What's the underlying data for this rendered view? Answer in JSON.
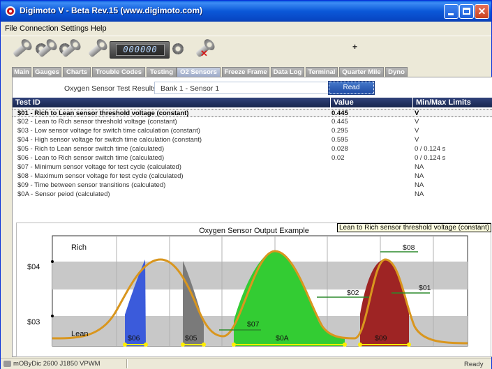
{
  "window": {
    "title": "Digimoto V - Beta Rev.15 (www.digimoto.com)"
  },
  "menu": [
    "File",
    "Connection",
    "Settings",
    "Help"
  ],
  "toolbar": {
    "counter": "000000"
  },
  "tabs": [
    {
      "label": "Main"
    },
    {
      "label": "Gauges"
    },
    {
      "label": "Charts"
    },
    {
      "label": "Trouble Codes"
    },
    {
      "label": "Testing"
    },
    {
      "label": "O2 Sensors",
      "active": true
    },
    {
      "label": "Freeze Frame"
    },
    {
      "label": "Data Log"
    },
    {
      "label": "Terminal"
    },
    {
      "label": "Quarter Mile"
    },
    {
      "label": "Dyno"
    }
  ],
  "sensor": {
    "label": "Oxygen Sensor Test Results:",
    "selected": "Bank 1 - Sensor 1",
    "read_button": "Read"
  },
  "table": {
    "headers": [
      "Test ID",
      "Value",
      "Min/Max Limits"
    ],
    "rows": [
      {
        "id": "$01 - Rich to Lean sensor threshold voltage (constant)",
        "value": "0.445",
        "limits": "V",
        "selected": true
      },
      {
        "id": "$02 - Lean to Rich sensor threshold voltage (constant)",
        "value": "0.445",
        "limits": "V"
      },
      {
        "id": "$03 - Low sensor voltage for switch time calculation (constant)",
        "value": "0.295",
        "limits": "V"
      },
      {
        "id": "$04 - High sensor voltage for switch time calculation (constant)",
        "value": "0.595",
        "limits": "V"
      },
      {
        "id": "$05 - Rich to Lean sensor switch time (calculated)",
        "value": "0.028",
        "limits": "0 / 0.124 s"
      },
      {
        "id": "$06 - Lean to Rich sensor switch time (calculated)",
        "value": "0.02",
        "limits": "0 / 0.124 s"
      },
      {
        "id": "$07 - Minimum sensor voltage for test cycle (calculated)",
        "value": "",
        "limits": "NA"
      },
      {
        "id": "$08 - Maximum sensor voltage for test cycle (calculated)",
        "value": "",
        "limits": "NA"
      },
      {
        "id": "$09 - Time between sensor transitions (calculated)",
        "value": "",
        "limits": "NA"
      },
      {
        "id": "$0A - Sensor peiod (calculated)",
        "value": "",
        "limits": "NA"
      }
    ]
  },
  "diagram": {
    "title": "Oxygen Sensor Output Example",
    "rich_label": "Rich",
    "lean_label": "Lean",
    "y_labels": [
      "$04",
      "$03"
    ],
    "region_labels": [
      "$06",
      "$05",
      "$07",
      "$0A",
      "$09",
      "$08",
      "$02",
      "$01"
    ],
    "colors": {
      "blue": "#3b5bdb",
      "gray": "#7a7a7a",
      "green": "#33cc33",
      "red": "#9e2424",
      "curve": "#d9961e",
      "band": "#c8c8c8"
    }
  },
  "tooltip": "Lean to Rich sensor threshold voltage (constant)",
  "status": {
    "left": "mOByDic 2600 J1850 VPWM",
    "right": "Ready"
  }
}
